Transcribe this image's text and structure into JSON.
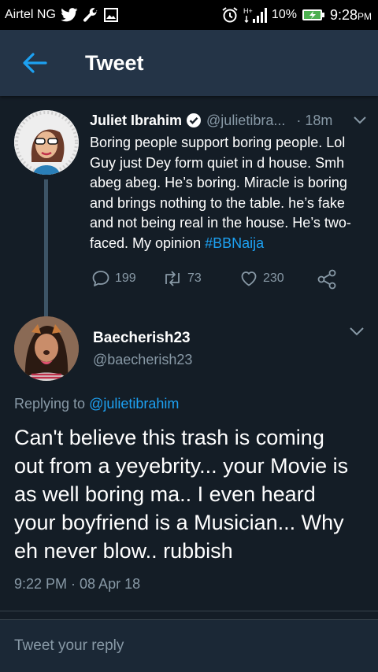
{
  "status_bar": {
    "carrier": "Airtel NG",
    "battery": "10%",
    "time": "9:28",
    "time_suffix": "PM",
    "network": "H+"
  },
  "header": {
    "title": "Tweet"
  },
  "original_tweet": {
    "name": "Juliet Ibrahim",
    "handle": "@julietibra...",
    "time": "· 18m",
    "text_lines": [
      "Boring people support boring people. Lol",
      "Guy just Dey form quiet in d house. Smh",
      "abeg abeg. He’s boring. Miracle is boring",
      "and brings nothing to the table. he’s fake",
      "and not being real in the house. He’s two-"
    ],
    "last_line_text": "faced. My opinion ",
    "hashtag": "#BBNaija",
    "replies": "199",
    "retweets": "73",
    "likes": "230"
  },
  "reply_tweet": {
    "name": "Baecherish23",
    "handle": "@baecherish23",
    "replying_to_label": "Replying to ",
    "replying_to_handle": "@julietibrahim",
    "text_lines": [
      "Can't believe this trash is coming",
      "out from a yeyebrity... your Movie is",
      "as well boring ma.. I even heard",
      "your boyfriend is a Musician... Why",
      "eh never blow.. rubbish"
    ],
    "timestamp": "9:22 PM · 08 Apr 18"
  },
  "reply_box": {
    "placeholder": "Tweet your reply"
  },
  "colors": {
    "background": "#141d26",
    "header": "#243447",
    "accent": "#1da1f2",
    "muted": "#8899a6"
  }
}
